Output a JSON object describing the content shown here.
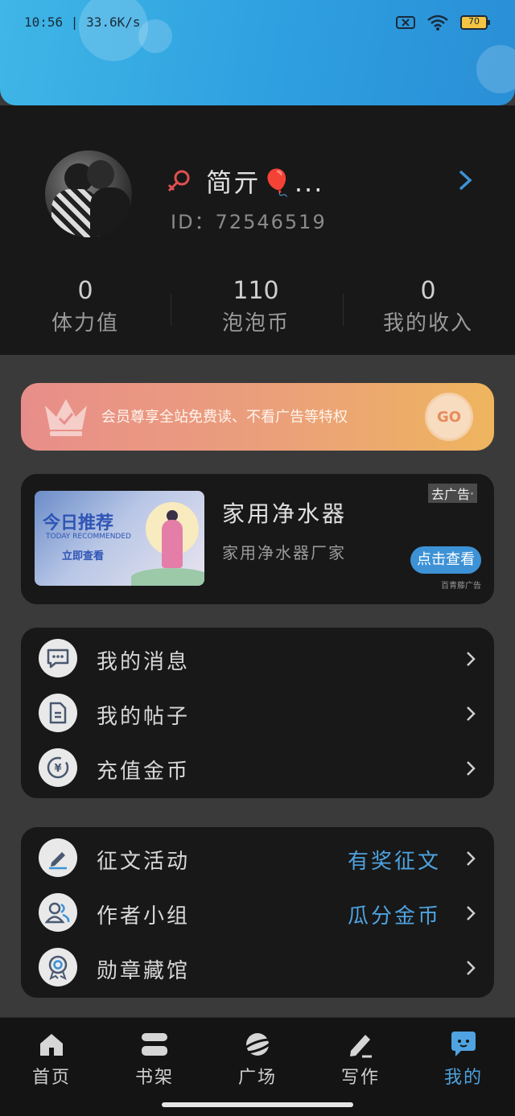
{
  "status_bar": {
    "time_speed": "10:56 | 33.6K/s",
    "battery": "70"
  },
  "profile": {
    "username": "简亓🎈...",
    "user_id": "ID：72546519"
  },
  "stats": [
    {
      "value": "0",
      "label": "体力值"
    },
    {
      "value": "110",
      "label": "泡泡币"
    },
    {
      "value": "0",
      "label": "我的收入"
    }
  ],
  "vip": {
    "text": "会员尊享全站免费读、不看广告等特权",
    "go_label": "GO"
  },
  "ad": {
    "image_title": "今日推荐",
    "image_subtitle": "TODAY RECOMMENDED",
    "image_button": "立即查看",
    "title": "家用净水器",
    "description": "家用净水器厂家",
    "tag": "去广告",
    "button": "点击查看",
    "source": "百青藤广告"
  },
  "menu_group_1": [
    {
      "label": "我的消息",
      "icon": "message-icon"
    },
    {
      "label": "我的帖子",
      "icon": "document-icon"
    },
    {
      "label": "充值金币",
      "icon": "coin-icon"
    }
  ],
  "menu_group_2": [
    {
      "label": "征文活动",
      "tag": "有奖征文",
      "icon": "pen-icon"
    },
    {
      "label": "作者小组",
      "tag": "瓜分金币",
      "icon": "group-icon"
    },
    {
      "label": "勋章藏馆",
      "tag": "",
      "icon": "medal-icon"
    }
  ],
  "bottom_nav": [
    {
      "label": "首页",
      "icon": "home-icon"
    },
    {
      "label": "书架",
      "icon": "bookshelf-icon"
    },
    {
      "label": "广场",
      "icon": "planet-icon"
    },
    {
      "label": "写作",
      "icon": "write-icon"
    },
    {
      "label": "我的",
      "icon": "profile-bubble-icon"
    }
  ],
  "colors": {
    "accent": "#4ea3e0",
    "banner_start": "#3fb6e6",
    "vip_start": "#e88e8a",
    "vip_end": "#eeb55e"
  }
}
